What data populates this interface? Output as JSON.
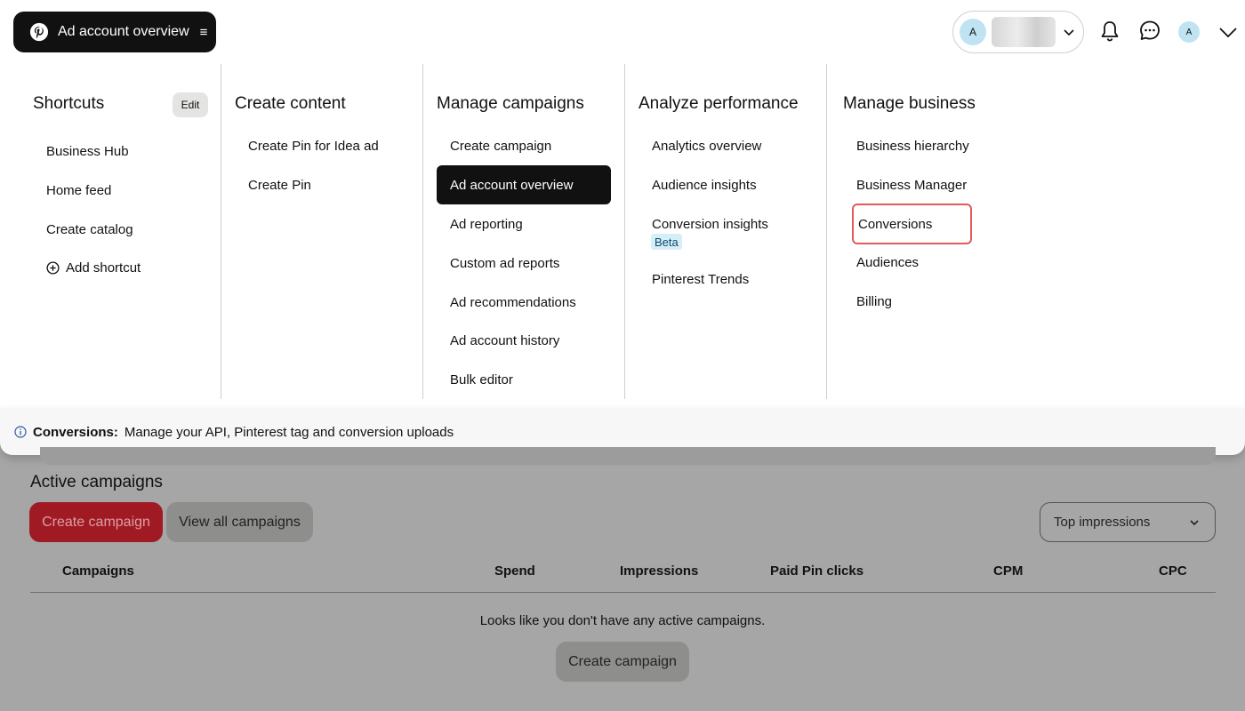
{
  "header": {
    "nav_label": "Ad account overview",
    "account_avatar": "A",
    "user_avatar": "A",
    "icons": [
      "pinterest-logo",
      "menu-icon",
      "chevron-down-icon",
      "bell-icon",
      "chat-icon"
    ]
  },
  "menu": {
    "shortcuts": {
      "title": "Shortcuts",
      "edit_label": "Edit",
      "items": [
        "Business Hub",
        "Home feed",
        "Create catalog"
      ],
      "add_label": "Add shortcut"
    },
    "create_content": {
      "title": "Create content",
      "items": [
        "Create Pin for Idea ad",
        "Create Pin"
      ]
    },
    "manage_campaigns": {
      "title": "Manage campaigns",
      "items": [
        "Create campaign",
        "Ad account overview",
        "Ad reporting",
        "Custom ad reports",
        "Ad recommendations",
        "Ad account history",
        "Bulk editor"
      ],
      "active_item": "Ad account overview"
    },
    "analyze_performance": {
      "title": "Analyze performance",
      "items": [
        "Analytics overview",
        "Audience insights",
        "Conversion insights",
        "Pinterest Trends"
      ],
      "beta_label": "Beta"
    },
    "manage_business": {
      "title": "Manage business",
      "items": [
        "Business hierarchy",
        "Business Manager",
        "Conversions",
        "Audiences",
        "Billing"
      ],
      "highlighted_item": "Conversions"
    }
  },
  "tooltip": {
    "title": "Conversions:",
    "description": "Manage your API, Pinterest tag and conversion uploads"
  },
  "page": {
    "section_title": "Active campaigns",
    "create_button": "Create campaign",
    "view_all_button": "View all campaigns",
    "sort_label": "Top impressions",
    "table_headers": [
      "Campaigns",
      "Spend",
      "Impressions",
      "Paid Pin clicks",
      "CPM",
      "CPC"
    ],
    "empty_message": "Looks like you don't have any active campaigns.",
    "empty_create_button": "Create campaign"
  },
  "colors": {
    "accent_black": "#111111",
    "highlight_border": "#e35a5a",
    "brand_red": "#e60023",
    "beta_bg": "#d6eefa",
    "overlay": "#a6a6a6"
  }
}
